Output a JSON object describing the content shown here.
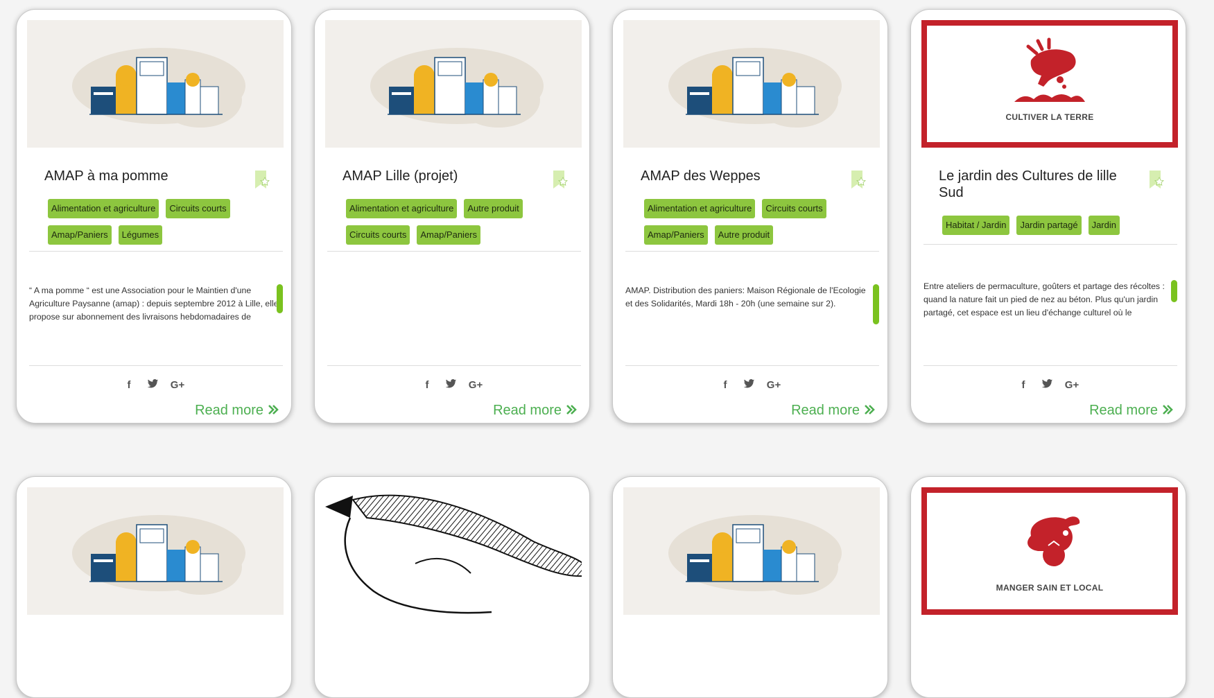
{
  "cards": [
    {
      "title": "AMAP à ma pomme",
      "tags": [
        "Alimentation et agriculture",
        "Circuits courts",
        "Amap/Paniers",
        "Légumes"
      ],
      "description": "“ A ma pomme “ est une Association pour le Maintien d'une Agriculture Paysanne (amap) : depuis septembre 2012 à Lille, elle propose sur abonnement des livraisons hebdomadaires de",
      "read_more": "Read more"
    },
    {
      "title": "AMAP Lille (projet)",
      "tags": [
        "Alimentation et agriculture",
        "Autre produit",
        "Circuits courts",
        "Amap/Paniers"
      ],
      "description": "",
      "read_more": "Read more"
    },
    {
      "title": "AMAP des Weppes",
      "tags": [
        "Alimentation et agriculture",
        "Circuits courts",
        "Amap/Paniers",
        "Autre produit"
      ],
      "description": "AMAP. Distribution des paniers: Maison Régionale de l'Ecologie et des Solidarités, Mardi 18h - 20h (une semaine sur 2).",
      "read_more": "Read more"
    },
    {
      "title": "Le jardin des Cultures de lille Sud",
      "tags": [
        "Habitat / Jardin",
        "Jardin partagé",
        "Jardin"
      ],
      "description": "Entre ateliers de permaculture, goûters et partage des récoltes : quand la nature fait un pied de nez au béton. Plus qu'un jardin partagé, cet espace est un lieu d'échange culturel où le",
      "logo_caption": "CULTIVER LA TERRE",
      "read_more": "Read more"
    }
  ],
  "row2": {
    "logo_caption": "MANGER SAIN ET LOCAL"
  },
  "social_icons": [
    "facebook-icon",
    "twitter-icon",
    "google-plus-icon"
  ],
  "colors": {
    "tag_green": "#8dc63f",
    "read_more_green": "#4caf50",
    "logo_red": "#c3222a",
    "page_bg": "#f4f4f4"
  }
}
